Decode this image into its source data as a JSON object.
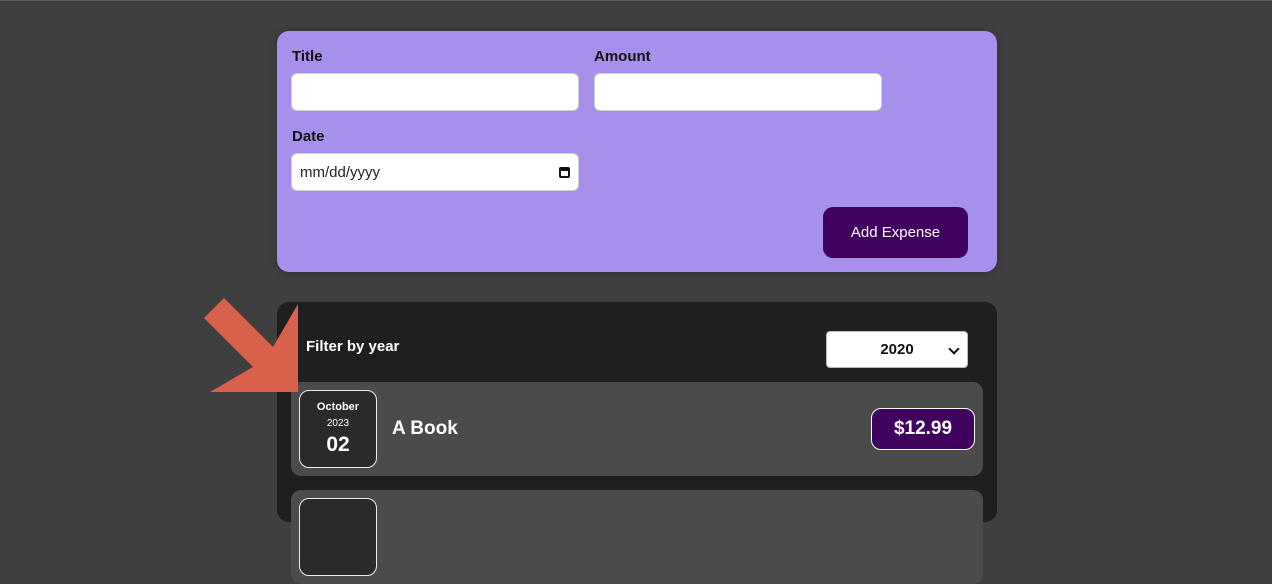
{
  "form": {
    "title_label": "Title",
    "title_value": "",
    "amount_label": "Amount",
    "amount_value": "",
    "date_label": "Date",
    "date_placeholder": "mm/dd/yyyy",
    "submit_label": "Add Expense"
  },
  "filter": {
    "label": "Filter by year",
    "selected_year": "2020"
  },
  "expenses": [
    {
      "month": "October",
      "year": "2023",
      "day": "02",
      "title": "A Book",
      "amount": "$12.99"
    }
  ],
  "colors": {
    "page_bg": "#3f3f3f",
    "form_bg": "#a78fec",
    "accent": "#40005d",
    "list_bg": "#1f1f1f",
    "item_bg": "#4b4b4b",
    "annotation_arrow": "#d9604a"
  },
  "icons": {
    "date_picker": "calendar-icon",
    "select": "chevron-down-icon",
    "annotation": "arrow-down-right-icon"
  }
}
